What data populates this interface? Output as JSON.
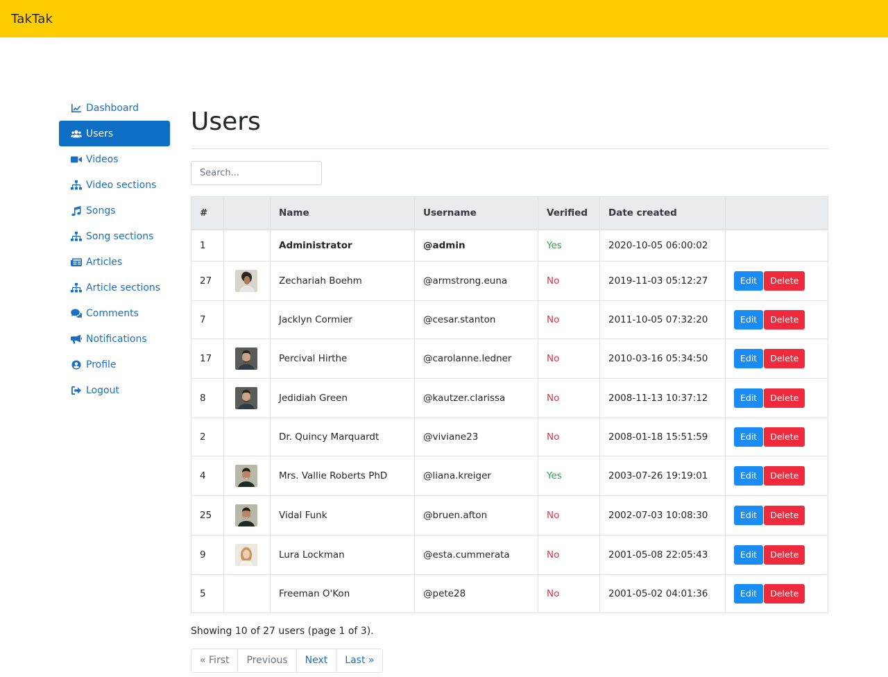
{
  "app": {
    "brand": "TakTak"
  },
  "sidebar": {
    "items": [
      {
        "label": "Dashboard",
        "icon": "chart-line-icon",
        "active": false
      },
      {
        "label": "Users",
        "icon": "users-icon",
        "active": true
      },
      {
        "label": "Videos",
        "icon": "video-icon",
        "active": false
      },
      {
        "label": "Video sections",
        "icon": "sitemap-icon",
        "active": false
      },
      {
        "label": "Songs",
        "icon": "music-icon",
        "active": false
      },
      {
        "label": "Song sections",
        "icon": "sitemap-icon",
        "active": false
      },
      {
        "label": "Articles",
        "icon": "newspaper-icon",
        "active": false
      },
      {
        "label": "Article sections",
        "icon": "sitemap-icon",
        "active": false
      },
      {
        "label": "Comments",
        "icon": "comments-icon",
        "active": false
      },
      {
        "label": "Notifications",
        "icon": "bullhorn-icon",
        "active": false
      },
      {
        "label": "Profile",
        "icon": "user-circle-icon",
        "active": false
      },
      {
        "label": "Logout",
        "icon": "sign-out-icon",
        "active": false
      }
    ]
  },
  "main": {
    "title": "Users",
    "search": {
      "placeholder": "Search...",
      "value": ""
    }
  },
  "table": {
    "headers": [
      "#",
      "",
      "Name",
      "Username",
      "Verified",
      "Date created",
      ""
    ],
    "rows": [
      {
        "id": "1",
        "avatar": "",
        "name": "Administrator",
        "username": "@admin",
        "verified": "Yes",
        "created": "2020-10-05 06:00:02",
        "actions": false
      },
      {
        "id": "27",
        "avatar": "photo-a",
        "name": "Zechariah Boehm",
        "username": "@armstrong.euna",
        "verified": "No",
        "created": "2019-11-03 05:12:27",
        "actions": true
      },
      {
        "id": "7",
        "avatar": "",
        "name": "Jacklyn Cormier",
        "username": "@cesar.stanton",
        "verified": "No",
        "created": "2011-10-05 07:32:20",
        "actions": true
      },
      {
        "id": "17",
        "avatar": "photo-b",
        "name": "Percival Hirthe",
        "username": "@carolanne.ledner",
        "verified": "No",
        "created": "2010-03-16 05:34:50",
        "actions": true
      },
      {
        "id": "8",
        "avatar": "photo-b",
        "name": "Jedidiah Green",
        "username": "@kautzer.clarissa",
        "verified": "No",
        "created": "2008-11-13 10:37:12",
        "actions": true
      },
      {
        "id": "2",
        "avatar": "",
        "name": "Dr. Quincy Marquardt",
        "username": "@viviane23",
        "verified": "No",
        "created": "2008-01-18 15:51:59",
        "actions": true
      },
      {
        "id": "4",
        "avatar": "photo-c",
        "name": "Mrs. Vallie Roberts PhD",
        "username": "@liana.kreiger",
        "verified": "Yes",
        "created": "2003-07-26 19:19:01",
        "actions": true
      },
      {
        "id": "25",
        "avatar": "photo-c",
        "name": "Vidal Funk",
        "username": "@bruen.afton",
        "verified": "No",
        "created": "2002-07-03 10:08:30",
        "actions": true
      },
      {
        "id": "9",
        "avatar": "photo-d",
        "name": "Lura Lockman",
        "username": "@esta.cummerata",
        "verified": "No",
        "created": "2001-05-08 22:05:43",
        "actions": true
      },
      {
        "id": "5",
        "avatar": "",
        "name": "Freeman O'Kon",
        "username": "@pete28",
        "verified": "No",
        "created": "2001-05-02 04:01:36",
        "actions": true
      }
    ],
    "edit_label": "Edit",
    "delete_label": "Delete"
  },
  "summary": "Showing 10 of 27 users (page 1 of 3).",
  "pagination": {
    "first": "« First",
    "previous": "Previous",
    "next": "Next",
    "last": "Last »"
  },
  "colors": {
    "topbar": "#ffcd00",
    "link": "#1a6fc0",
    "active": "#0d6ec5",
    "edit": "#1b8cf3",
    "delete": "#ef2a3c",
    "yes": "#28a745",
    "no": "#dc3545"
  }
}
